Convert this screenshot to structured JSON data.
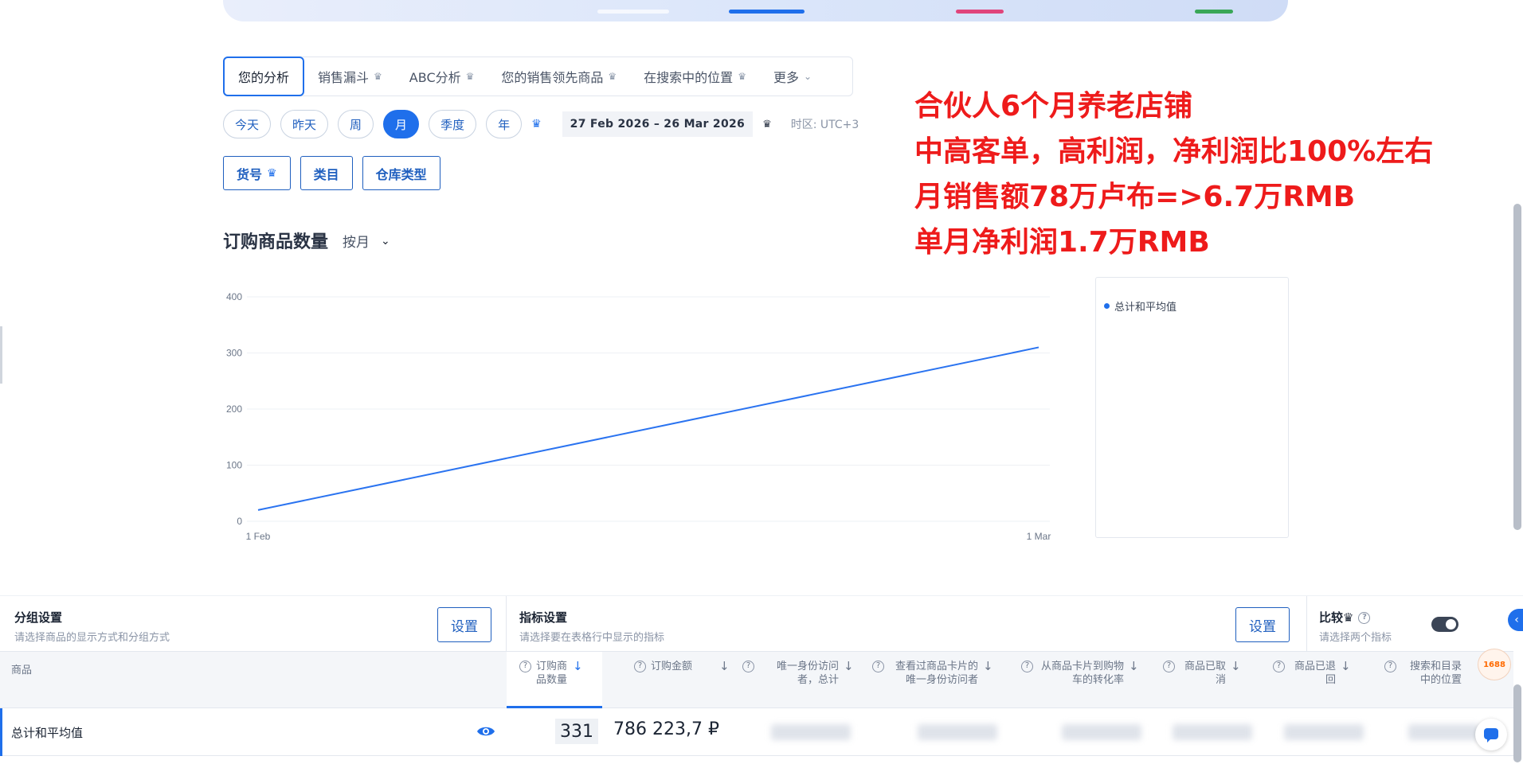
{
  "tabs": [
    {
      "label": "您的分析"
    },
    {
      "label": "销售漏斗"
    },
    {
      "label": "ABC分析"
    },
    {
      "label": "您的销售领先商品"
    },
    {
      "label": "在搜索中的位置"
    },
    {
      "label": "更多"
    }
  ],
  "periods": [
    "今天",
    "昨天",
    "周",
    "月",
    "季度",
    "年"
  ],
  "active_period": "月",
  "date_range": "27 Feb 2026 – 26 Mar 2026",
  "timezone": "时区:  UTC+3",
  "filters": [
    "货号",
    "类目",
    "仓库类型"
  ],
  "chart": {
    "title": "订购商品数量",
    "group_by": "按月"
  },
  "chart_data": {
    "type": "line",
    "x": [
      "1 Feb",
      "1 Mar"
    ],
    "series": [
      {
        "name": "总计和平均值",
        "values": [
          20,
          310
        ]
      }
    ],
    "ylim": [
      0,
      400
    ],
    "yticks": [
      0,
      100,
      200,
      300,
      400
    ],
    "grid": true,
    "legend_position": "right",
    "color": "#2a73f0"
  },
  "overlay_text": [
    "合伙人6个月养老店铺",
    "中高客单，高利润，净利润比100%左右",
    "月销售额78万卢布=>6.7万RMB",
    "单月净利润1.7万RMB"
  ],
  "grouping_settings": {
    "title": "分组设置",
    "subtitle": "请选择商品的显示方式和分组方式",
    "button": "设置"
  },
  "metric_settings": {
    "title": "指标设置",
    "subtitle": "请选择要在表格行中显示的指标",
    "button": "设置"
  },
  "compare": {
    "title": "比较",
    "subtitle": "请选择两个指标"
  },
  "table": {
    "product_header": "商品",
    "columns": [
      "订购商品数量",
      "订购金额",
      "唯一身份访问者，总计",
      "查看过商品卡片的唯一身份访问者",
      "从商品卡片到购物车的转化率",
      "商品已取消",
      "商品已退回",
      "搜索和目录中的位置"
    ],
    "rows": [
      {
        "label": "总计和平均值",
        "quantity": "331",
        "amount": "786 223,7 ₽"
      }
    ]
  },
  "logo": "1688",
  "colors": {
    "accent": "#1f6feb",
    "overlay_red": "#ee1b1b"
  }
}
